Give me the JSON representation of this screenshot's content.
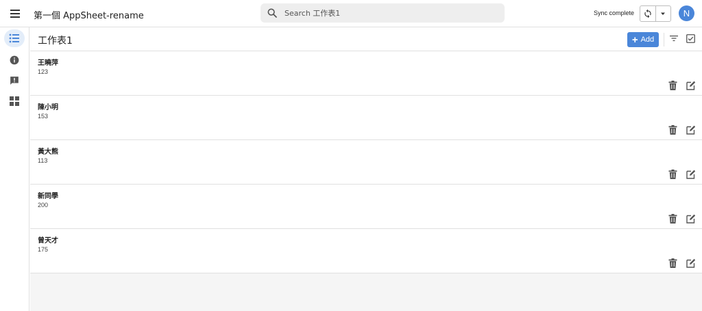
{
  "app": {
    "title": "第一個 AppSheet-rename"
  },
  "search": {
    "placeholder": "Search 工作表1"
  },
  "sync": {
    "status": "Sync complete"
  },
  "user": {
    "initial": "N"
  },
  "view": {
    "title": "工作表1",
    "add_label": "Add"
  },
  "rows": [
    {
      "name": "王曉萍",
      "value": "123"
    },
    {
      "name": "陳小明",
      "value": "153"
    },
    {
      "name": "黃大熊",
      "value": "113"
    },
    {
      "name": "新同學",
      "value": "200"
    },
    {
      "name": "曾天才",
      "value": "175"
    }
  ],
  "icons": {
    "menu": "hamburger-menu-icon",
    "search": "search-icon",
    "sync": "sync-icon",
    "caret": "caret-down-icon",
    "list_view": "list-view-icon",
    "info": "info-icon",
    "feedback": "feedback-icon",
    "dashboard": "dashboard-icon",
    "filter": "filter-icon",
    "select": "checkbox-select-icon",
    "delete": "trash-icon",
    "edit": "edit-icon"
  },
  "colors": {
    "accent": "#4a86d9",
    "rail_active": "#e3edf9",
    "background": "#f5f5f5"
  }
}
